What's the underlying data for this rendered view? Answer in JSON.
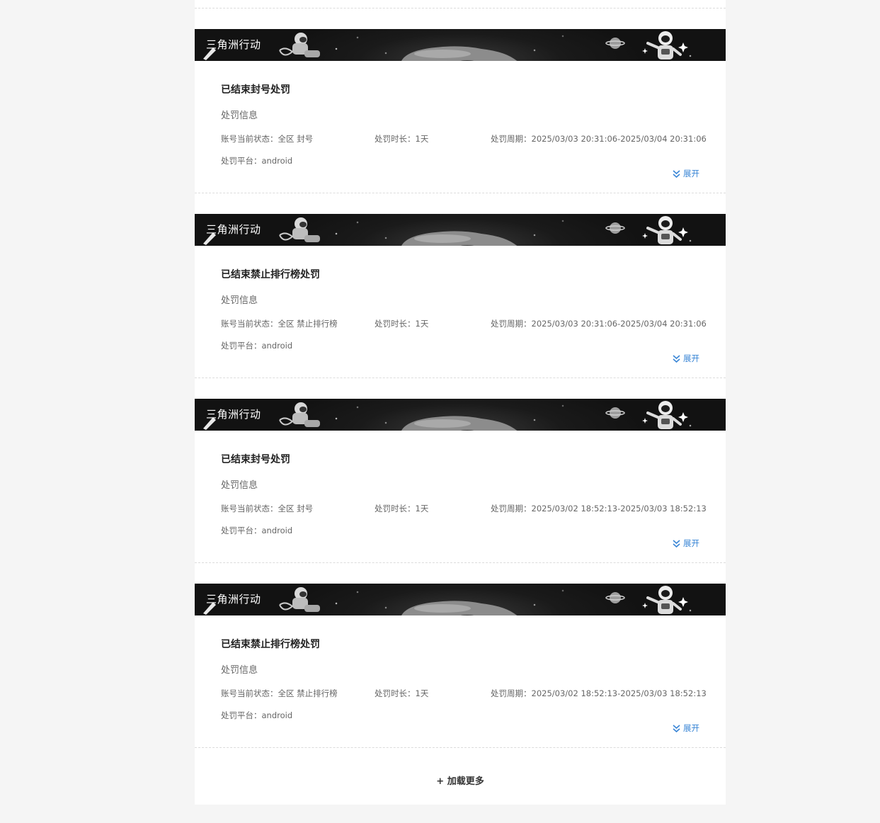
{
  "cards": [
    {
      "banner_title": "三角洲行动",
      "heading": "已结束封号处罚",
      "section_label": "处罚信息",
      "status_label": "账号当前状态：",
      "status_value": "全区 封号",
      "duration_label": "处罚时长：",
      "duration_value": "1天",
      "period_label": "处罚周期：",
      "period_value": "2025/03/03 20:31:06-2025/03/04 20:31:06",
      "platform_label": "处罚平台：",
      "platform_value": "android",
      "expand_label": "展开"
    },
    {
      "banner_title": "三角洲行动",
      "heading": "已结束禁止排行榜处罚",
      "section_label": "处罚信息",
      "status_label": "账号当前状态：",
      "status_value": "全区 禁止排行榜",
      "duration_label": "处罚时长：",
      "duration_value": "1天",
      "period_label": "处罚周期：",
      "period_value": "2025/03/03 20:31:06-2025/03/04 20:31:06",
      "platform_label": "处罚平台：",
      "platform_value": "android",
      "expand_label": "展开"
    },
    {
      "banner_title": "三角洲行动",
      "heading": "已结束封号处罚",
      "section_label": "处罚信息",
      "status_label": "账号当前状态：",
      "status_value": "全区 封号",
      "duration_label": "处罚时长：",
      "duration_value": "1天",
      "period_label": "处罚周期：",
      "period_value": "2025/03/02 18:52:13-2025/03/03 18:52:13",
      "platform_label": "处罚平台：",
      "platform_value": "android",
      "expand_label": "展开"
    },
    {
      "banner_title": "三角洲行动",
      "heading": "已结束禁止排行榜处罚",
      "section_label": "处罚信息",
      "status_label": "账号当前状态：",
      "status_value": "全区 禁止排行榜",
      "duration_label": "处罚时长：",
      "duration_value": "1天",
      "period_label": "处罚周期：",
      "period_value": "2025/03/02 18:52:13-2025/03/03 18:52:13",
      "platform_label": "处罚平台：",
      "platform_value": "android",
      "expand_label": "展开"
    }
  ],
  "load_more": "+ 加载更多",
  "colors": {
    "accent": "#3a86d6",
    "banner_bg": "#121212",
    "page_bg": "#f5f5f5"
  },
  "icons": {
    "expand": "double-chevron-down-icon",
    "banner_art": "astronaut-moon-banner"
  }
}
